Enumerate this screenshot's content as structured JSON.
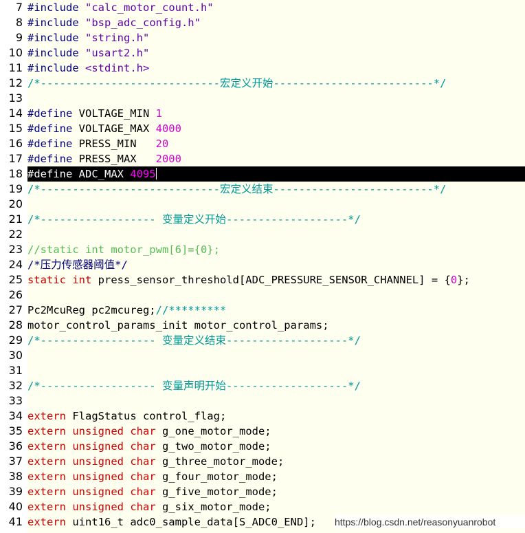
{
  "editor": {
    "lines": [
      {
        "n": "7",
        "t": [
          [
            "dir",
            "#include "
          ],
          [
            "str",
            "\"calc_motor_count.h\""
          ]
        ]
      },
      {
        "n": "8",
        "t": [
          [
            "dir",
            "#include "
          ],
          [
            "str",
            "\"bsp_adc_config.h\""
          ]
        ]
      },
      {
        "n": "9",
        "t": [
          [
            "dir",
            "#include "
          ],
          [
            "str",
            "\"string.h\""
          ]
        ]
      },
      {
        "n": "10",
        "t": [
          [
            "dir",
            "#include "
          ],
          [
            "str",
            "\"usart2.h\""
          ]
        ]
      },
      {
        "n": "11",
        "t": [
          [
            "dir",
            "#include "
          ],
          [
            "str",
            "<stdint.h>"
          ]
        ]
      },
      {
        "n": "12",
        "t": [
          [
            "comment",
            "/*----------------------------宏定义开始-------------------------*/"
          ]
        ]
      },
      {
        "n": "13",
        "t": []
      },
      {
        "n": "14",
        "t": [
          [
            "dir",
            "#define "
          ],
          [
            "plain",
            "VOLTAGE_MIN "
          ],
          [
            "num",
            "1"
          ]
        ]
      },
      {
        "n": "15",
        "t": [
          [
            "dir",
            "#define "
          ],
          [
            "plain",
            "VOLTAGE_MAX "
          ],
          [
            "num",
            "4000"
          ]
        ]
      },
      {
        "n": "16",
        "t": [
          [
            "dir",
            "#define "
          ],
          [
            "plain",
            "PRESS_MIN   "
          ],
          [
            "num",
            "20"
          ]
        ]
      },
      {
        "n": "17",
        "t": [
          [
            "dir",
            "#define "
          ],
          [
            "plain",
            "PRESS_MAX   "
          ],
          [
            "num",
            "2000"
          ]
        ]
      },
      {
        "n": "18",
        "t": [
          [
            "dir",
            "#define "
          ],
          [
            "plain",
            "ADC_MAX "
          ],
          [
            "num",
            "4095"
          ]
        ],
        "current": true
      },
      {
        "n": "19",
        "t": [
          [
            "comment",
            "/*----------------------------宏定义结束-------------------------*/"
          ]
        ]
      },
      {
        "n": "20",
        "t": []
      },
      {
        "n": "21",
        "t": [
          [
            "comment",
            "/*------------------ 变量定义开始-------------------*/"
          ]
        ]
      },
      {
        "n": "22",
        "t": []
      },
      {
        "n": "23",
        "t": [
          [
            "commentold",
            "//static int motor_pwm[6]={0};"
          ]
        ]
      },
      {
        "n": "24",
        "t": [
          [
            "dir",
            "/*压力传感器阈值*/"
          ]
        ]
      },
      {
        "n": "25",
        "t": [
          [
            "kw",
            "static "
          ],
          [
            "kw",
            "int "
          ],
          [
            "plain",
            "press_sensor_threshold[ADC_PRESSURE_SENSOR_CHANNEL] = {"
          ],
          [
            "num",
            "0"
          ],
          [
            "plain",
            "};"
          ]
        ]
      },
      {
        "n": "26",
        "t": []
      },
      {
        "n": "27",
        "t": [
          [
            "plain",
            "Pc2McuReg pc2mcureg;"
          ],
          [
            "comment",
            "//*********"
          ]
        ]
      },
      {
        "n": "28",
        "t": [
          [
            "plain",
            "motor_control_params_init motor_control_params;"
          ]
        ]
      },
      {
        "n": "29",
        "t": [
          [
            "comment",
            "/*------------------ 变量定义结束-------------------*/"
          ]
        ]
      },
      {
        "n": "30",
        "t": []
      },
      {
        "n": "31",
        "t": []
      },
      {
        "n": "32",
        "t": [
          [
            "comment",
            "/*------------------ 变量声明开始-------------------*/"
          ]
        ]
      },
      {
        "n": "33",
        "t": []
      },
      {
        "n": "34",
        "t": [
          [
            "kw",
            "extern "
          ],
          [
            "plain",
            "FlagStatus control_flag;"
          ]
        ]
      },
      {
        "n": "35",
        "t": [
          [
            "kw",
            "extern "
          ],
          [
            "kw",
            "unsigned "
          ],
          [
            "kw",
            "char "
          ],
          [
            "plain",
            "g_one_motor_mode;"
          ]
        ]
      },
      {
        "n": "36",
        "t": [
          [
            "kw",
            "extern "
          ],
          [
            "kw",
            "unsigned "
          ],
          [
            "kw",
            "char "
          ],
          [
            "plain",
            "g_two_motor_mode;"
          ]
        ]
      },
      {
        "n": "37",
        "t": [
          [
            "kw",
            "extern "
          ],
          [
            "kw",
            "unsigned "
          ],
          [
            "kw",
            "char "
          ],
          [
            "plain",
            "g_three_motor_mode;"
          ]
        ]
      },
      {
        "n": "38",
        "t": [
          [
            "kw",
            "extern "
          ],
          [
            "kw",
            "unsigned "
          ],
          [
            "kw",
            "char "
          ],
          [
            "plain",
            "g_four_motor_mode;"
          ]
        ]
      },
      {
        "n": "39",
        "t": [
          [
            "kw",
            "extern "
          ],
          [
            "kw",
            "unsigned "
          ],
          [
            "kw",
            "char "
          ],
          [
            "plain",
            "g_five_motor_mode;"
          ]
        ]
      },
      {
        "n": "40",
        "t": [
          [
            "kw",
            "extern "
          ],
          [
            "kw",
            "unsigned "
          ],
          [
            "kw",
            "char "
          ],
          [
            "plain",
            "g_six_motor_mode;"
          ]
        ]
      },
      {
        "n": "41",
        "t": [
          [
            "kw",
            "extern "
          ],
          [
            "plain",
            "uint16_t adc0_sample_data[S_ADC0_END];"
          ]
        ]
      }
    ]
  },
  "watermark": "https://blog.csdn.net/reasonyuanrobot"
}
